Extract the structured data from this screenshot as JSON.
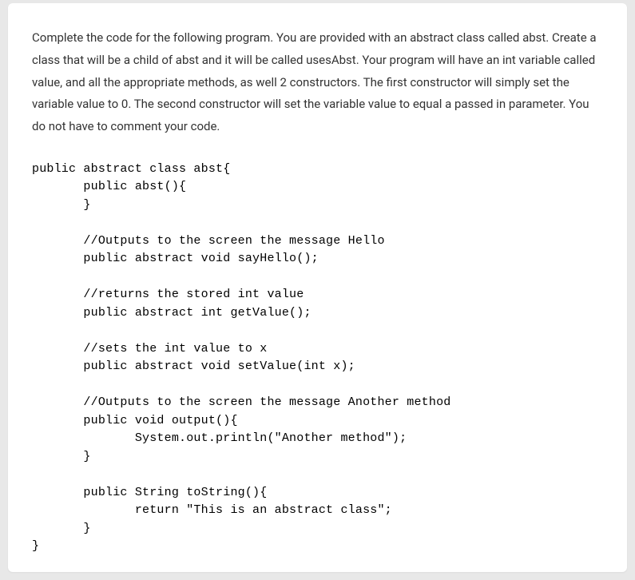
{
  "prompt": "Complete the code for the following program. You are provided with an abstract class called abst. Create a class that will be a child of abst and it will be called usesAbst. Your program will have an int variable called value, and all the appropriate methods, as well 2 constructors. The first constructor will simply set the variable value to 0. The second constructor will set the variable value to equal a passed in parameter. You do not have to comment your code.",
  "code": "public abstract class abst{\n       public abst(){\n       }\n\n       //Outputs to the screen the message Hello\n       public abstract void sayHello();\n\n       //returns the stored int value\n       public abstract int getValue();\n\n       //sets the int value to x\n       public abstract void setValue(int x);\n\n       //Outputs to the screen the message Another method\n       public void output(){\n              System.out.println(\"Another method\");\n       }\n\n       public String toString(){\n              return \"This is an abstract class\";\n       }\n}"
}
